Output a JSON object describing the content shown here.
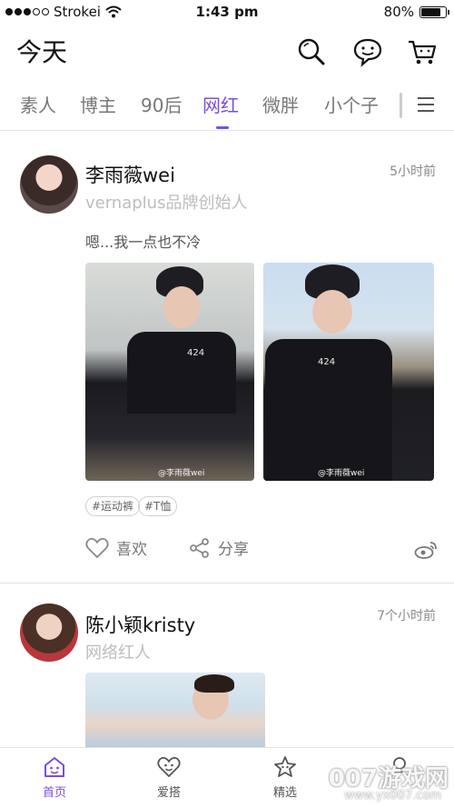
{
  "status_bar": {
    "carrier": "Strokei",
    "time": "1:43 pm",
    "battery": "80%",
    "battery_level": 0.8
  },
  "header": {
    "title": "今天",
    "icons": [
      "search-icon",
      "chat-bubble-icon",
      "cart-icon"
    ]
  },
  "tabs": {
    "items": [
      "素人",
      "博主",
      "90后",
      "网红",
      "微胖",
      "小个子"
    ],
    "active": "网红",
    "menu_icon": "hamburger-menu-icon"
  },
  "posts": [
    {
      "name": "李雨薇wei",
      "subtitle": "vernaplus品牌创始人",
      "time": "5小时前",
      "text": "嗯...我一点也不冷",
      "photo_texts": [
        "424",
        "424"
      ],
      "watermarks": [
        "@李雨薇wei",
        "@李雨薇wei"
      ],
      "tags": [
        "#运动裤",
        "#T恤"
      ],
      "actions": {
        "like_label": "喜欢",
        "share_label": "分享",
        "weibo_icon": "weibo-icon"
      }
    },
    {
      "name": "陈小颖kristy",
      "subtitle": "网络红人",
      "time": "7个小时前"
    }
  ],
  "bottom_nav": {
    "items": [
      {
        "label": "首页",
        "icon": "home-face-icon"
      },
      {
        "label": "爱搭",
        "icon": "heart-face-icon"
      },
      {
        "label": "精选",
        "icon": "star-face-icon"
      },
      {
        "label": "",
        "icon": "profile-icon"
      }
    ],
    "active": "首页"
  },
  "watermark": {
    "text": "007游戏网",
    "url": "www.yx007.com"
  },
  "colors": {
    "accent": "#7a4fd8",
    "muted_text": "#bdbdbd",
    "divider": "#e3e3e3"
  }
}
